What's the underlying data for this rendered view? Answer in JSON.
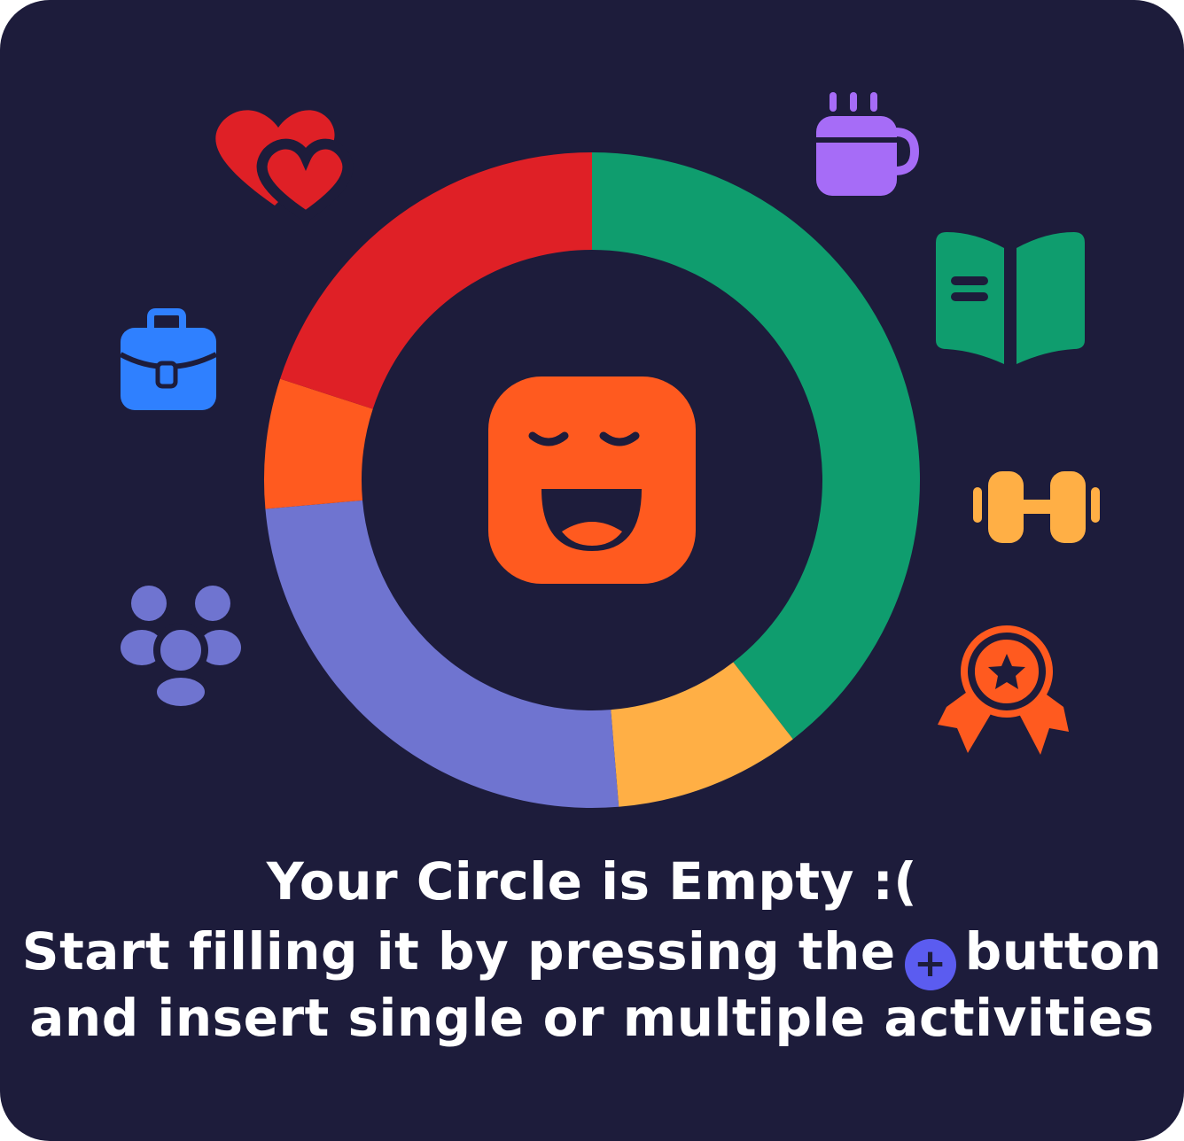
{
  "empty_state": {
    "title": "Your Circle is Empty :(",
    "line2_before": "Start filling it by pressing the",
    "line2_after": "button",
    "line3": "and insert single or multiple activities",
    "plus_symbol": "+"
  },
  "donut": {
    "segments": [
      {
        "category": "reading",
        "color": "#0f9d6e",
        "fraction": 0.395
      },
      {
        "category": "fitness",
        "color": "#ffaf45",
        "fraction": 0.092
      },
      {
        "category": "social",
        "color": "#6f74d0",
        "fraction": 0.249
      },
      {
        "category": "work",
        "color": "#ff5a1f",
        "fraction": 0.064
      },
      {
        "category": "love",
        "color": "#df2026",
        "fraction": 0.2
      }
    ],
    "center_icon": "laughing-face-icon"
  },
  "icons": [
    {
      "name": "hearts-icon",
      "color": "#df2026"
    },
    {
      "name": "briefcase-icon",
      "color": "#2f80ff"
    },
    {
      "name": "people-group-icon",
      "color": "#6f74d0"
    },
    {
      "name": "coffee-cup-icon",
      "color": "#a66cf7"
    },
    {
      "name": "open-book-icon",
      "color": "#0f9d6e"
    },
    {
      "name": "dumbbell-icon",
      "color": "#ffaf45"
    },
    {
      "name": "award-badge-icon",
      "color": "#ff5a1f"
    }
  ],
  "colors": {
    "background": "#1d1c3b",
    "text": "#ffffff",
    "plus_button": "#5b5cf0"
  }
}
